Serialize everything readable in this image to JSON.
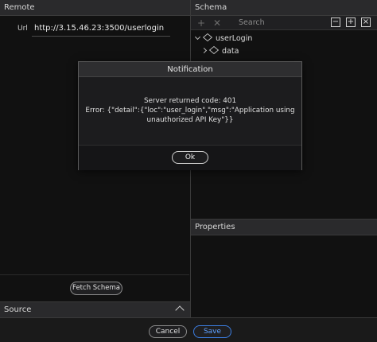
{
  "remote": {
    "title": "Remote",
    "url_label": "Url",
    "url_value": "http://3.15.46.23:3500/userlogin",
    "fetch_label": "Fetch Schema",
    "source_label": "Source"
  },
  "schema": {
    "title": "Schema",
    "search_placeholder": "Search",
    "tree": [
      {
        "label": "userLogin",
        "expanded": true
      },
      {
        "label": "data",
        "expanded": false
      }
    ]
  },
  "properties": {
    "title": "Properties"
  },
  "footer": {
    "cancel_label": "Cancel",
    "save_label": "Save"
  },
  "dialog": {
    "title": "Notification",
    "line1": "Server returned code: 401",
    "line2": "Error: {\"detail\":{\"loc\":\"user_login\",\"msg\":\"Application using",
    "line3": "unauthorized API Key\"}}",
    "ok_label": "Ok"
  },
  "colors": {
    "accent": "#3b7de0",
    "background": "#111111",
    "panel_header": "#2a2a2c"
  }
}
